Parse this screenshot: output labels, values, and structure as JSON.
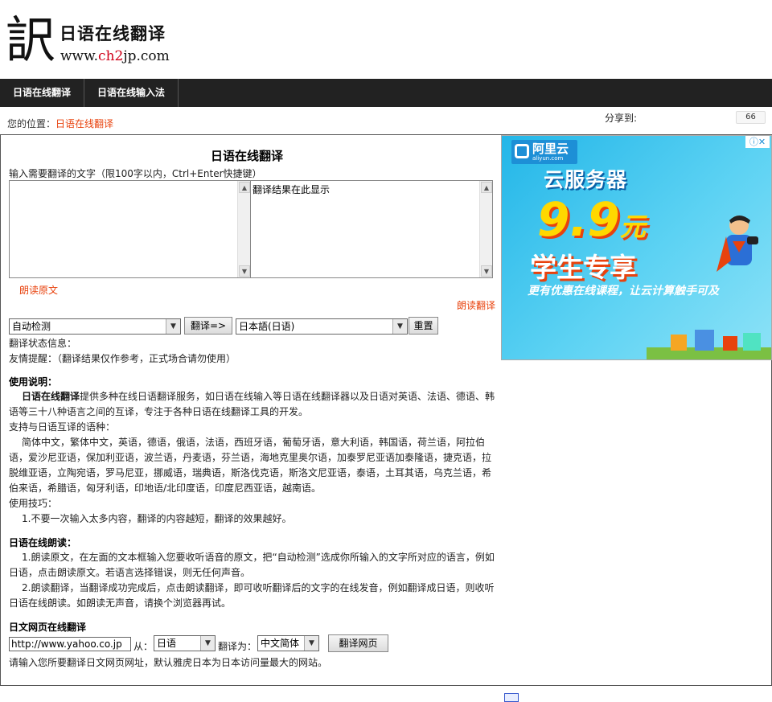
{
  "header": {
    "logo_kanji": "訳",
    "logo_title": "日语在线翻译",
    "logo_url_pre": "www.",
    "logo_url_hl": "ch2",
    "logo_url_post": "jp.com"
  },
  "nav": {
    "items": [
      {
        "label": "日语在线翻译"
      },
      {
        "label": "日语在线输入法"
      }
    ]
  },
  "breadcrumb": {
    "prefix": "您的位置：",
    "current": "日语在线翻译"
  },
  "share": {
    "label": "分享到:",
    "count": "66"
  },
  "tool": {
    "title": "日语在线翻译",
    "input_hint": "输入需要翻译的文字（限100字以内，Ctrl+Enter快捷键）",
    "source_value": "",
    "result_placeholder": "翻译结果在此显示",
    "read_source": "朗读原文",
    "read_result": "朗读翻译",
    "from_lang": "自动检测",
    "translate_button": "翻译=>",
    "to_lang": "日本語(日语)",
    "reset_button": "重置",
    "status": "翻译状态信息：",
    "tip": "友情提醒：（翻译结果仅作参考，正式场合请勿使用）"
  },
  "usage": {
    "title": "使用说明：",
    "intro_bold": "日语在线翻译",
    "intro_rest": "提供多种在线日语翻译服务，如日语在线输入等日语在线翻译器以及日语对英语、法语、德语、韩语等三十八种语言之间的互译，专注于各种日语在线翻译工具的开发。",
    "langs_title": "支持与日语互译的语种：",
    "langs": "简体中文，繁体中文，英语，德语，俄语，法语，西班牙语，葡萄牙语，意大利语，韩国语，荷兰语，阿拉伯语，爱沙尼亚语，保加利亚语，波兰语，丹麦语，芬兰语，海地克里奥尔语，加泰罗尼亚语加泰隆语，捷克语，拉脱维亚语，立陶宛语，罗马尼亚，挪威语，瑞典语，斯洛伐克语，斯洛文尼亚语，泰语，土耳其语，乌克兰语，希伯来语，希腊语，匈牙利语，印地语/北印度语，印度尼西亚语，越南语。",
    "tips_title": "使用技巧：",
    "tips_1": "1.不要一次输入太多内容，翻译的内容越短，翻译的效果越好。"
  },
  "reading": {
    "title": "日语在线朗读：",
    "p1": "1.朗读原文，在左面的文本框输入您要收听语音的原文，把“自动检测”选成你所输入的文字所对应的语言，例如日语，点击朗读原文。若语言选择错误，则无任何声音。",
    "p2": "2.朗读翻译，当翻译成功完成后，点击朗读翻译，即可收听翻译后的文字的在线发音，例如翻译成日语，则收听日语在线朗读。如朗读无声音，请换个浏览器再试。"
  },
  "webpage": {
    "title": "日文网页在线翻译",
    "url_value": "http://www.yahoo.co.jp",
    "from_label": "从：",
    "from_lang": "日语",
    "to_label": "翻译为：",
    "to_lang": "中文简体",
    "button": "翻译网页",
    "hint": "请输入您所要翻译日文网页网址，默认雅虎日本为日本访问量最大的网站。"
  },
  "ad": {
    "brand": "阿里云",
    "brand_sub": "aliyun.com",
    "line1": "云服务器",
    "price": "9.9",
    "price_unit": "元",
    "line3": "学生专享",
    "line4": "更有优惠在线课程，让云计算触手可及",
    "badge": "ⓘ✕"
  },
  "colors": {
    "nav_bg": "#222222",
    "link": "#e8420d",
    "ad_bg": "#23b6e8"
  }
}
